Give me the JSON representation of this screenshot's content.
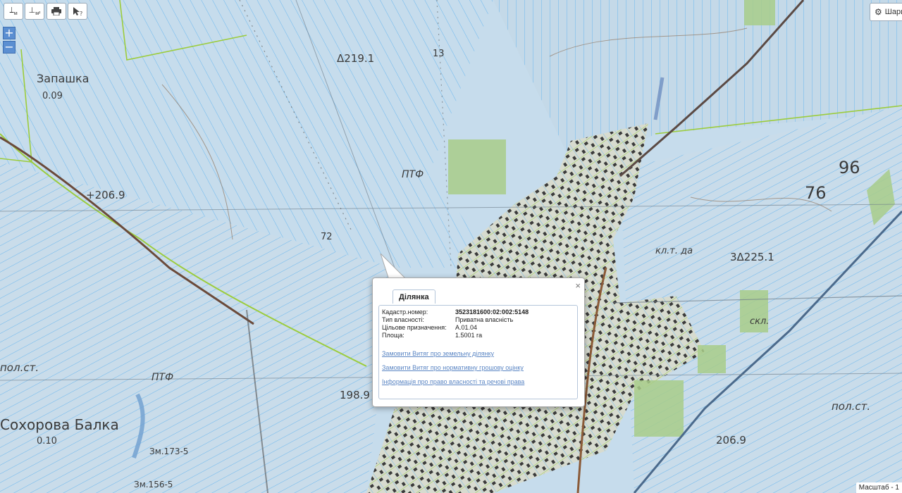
{
  "toolbar": {
    "measure_length_label": "м",
    "measure_area_label": "м²",
    "print_icon": "print-icon",
    "identify_icon": "cursor-question-icon"
  },
  "zoom": {
    "in_label": "+",
    "out_label": "−"
  },
  "layers_button": {
    "label": "Шари"
  },
  "scale": {
    "label": "Масштаб - 1"
  },
  "map_labels": {
    "zapashka": "Запашка",
    "zapashka_val": "0.09",
    "elev_219": "Δ219.1",
    "elev_206_9_left": "+206.9",
    "ptf_top": "ПТФ",
    "ptf_bottom": "ПТФ",
    "elev_198": "198.9",
    "sokhorova": "Сохорова Балка",
    "sokhorova_val": "0.10",
    "zm_173": "Зм.173-5",
    "zm_156": "Зм.156-5",
    "pol_st_left": "пол.ст.",
    "num_96": "96",
    "num_76": "76",
    "elev_225": "3Δ225.1",
    "skl": "скл.",
    "kl_tr": "кл.т.  да",
    "pol_st_right": "пол.ст.",
    "elev_206_9_right": "206.9",
    "num_13": "13",
    "num_72": "72"
  },
  "popup": {
    "tab_label": "Ділянка",
    "fields": [
      {
        "key": "Кадастр.номер:",
        "value": "3523181600:02:002:5148",
        "bold": true
      },
      {
        "key": "Тип власності:",
        "value": "Приватна власність",
        "bold": false
      },
      {
        "key": "Цільове призначення:",
        "value": "A.01.04",
        "bold": false
      },
      {
        "key": "Площа:",
        "value": "1.5001 га",
        "bold": false
      }
    ],
    "links": [
      "Замовити Витяг про земельну ділянку",
      "Замовити Витяг про нормативну грошову оцінку",
      "Інформація про право власності та речові права"
    ],
    "close_label": "×"
  }
}
